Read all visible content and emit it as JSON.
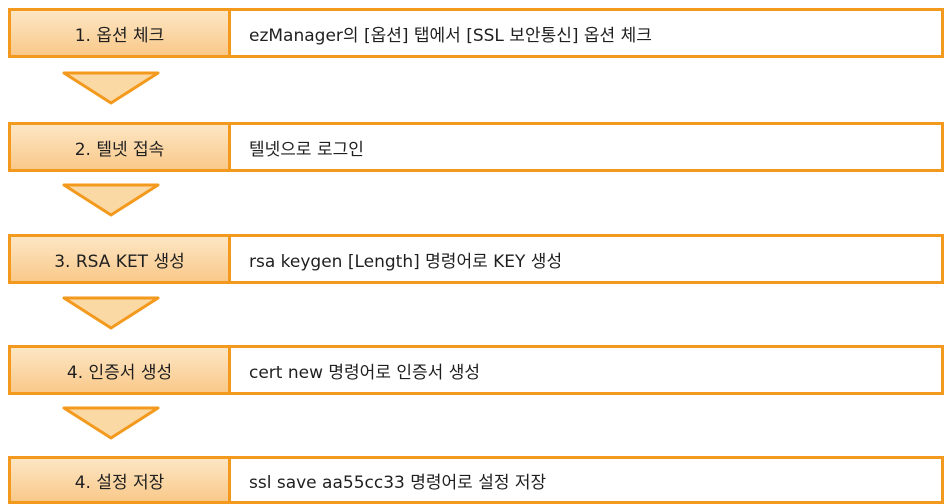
{
  "steps": [
    {
      "label": "1. 옵션 체크",
      "description": "ezManager의 [옵션] 탭에서 [SSL 보안통신] 옵션 체크"
    },
    {
      "label": "2. 텔넷 접속",
      "description": "텔넷으로 로그인"
    },
    {
      "label": "3. RSA KET 생성",
      "description": "rsa keygen [Length] 명령어로 KEY 생성"
    },
    {
      "label": "4. 인증서 생성",
      "description": "cert new 명령어로 인증서 생성"
    },
    {
      "label": "4. 설정 저장",
      "description": "ssl save aa55cc33 명령어로 설정 저장"
    }
  ],
  "colors": {
    "border": "#f39a1e",
    "label_fill_top": "#fde6c4",
    "label_fill_bottom": "#f9c98a",
    "arrow_fill": "#fbd9a5",
    "arrow_stroke": "#f39a1e"
  },
  "icons": {
    "connector": "down-arrow-icon"
  }
}
